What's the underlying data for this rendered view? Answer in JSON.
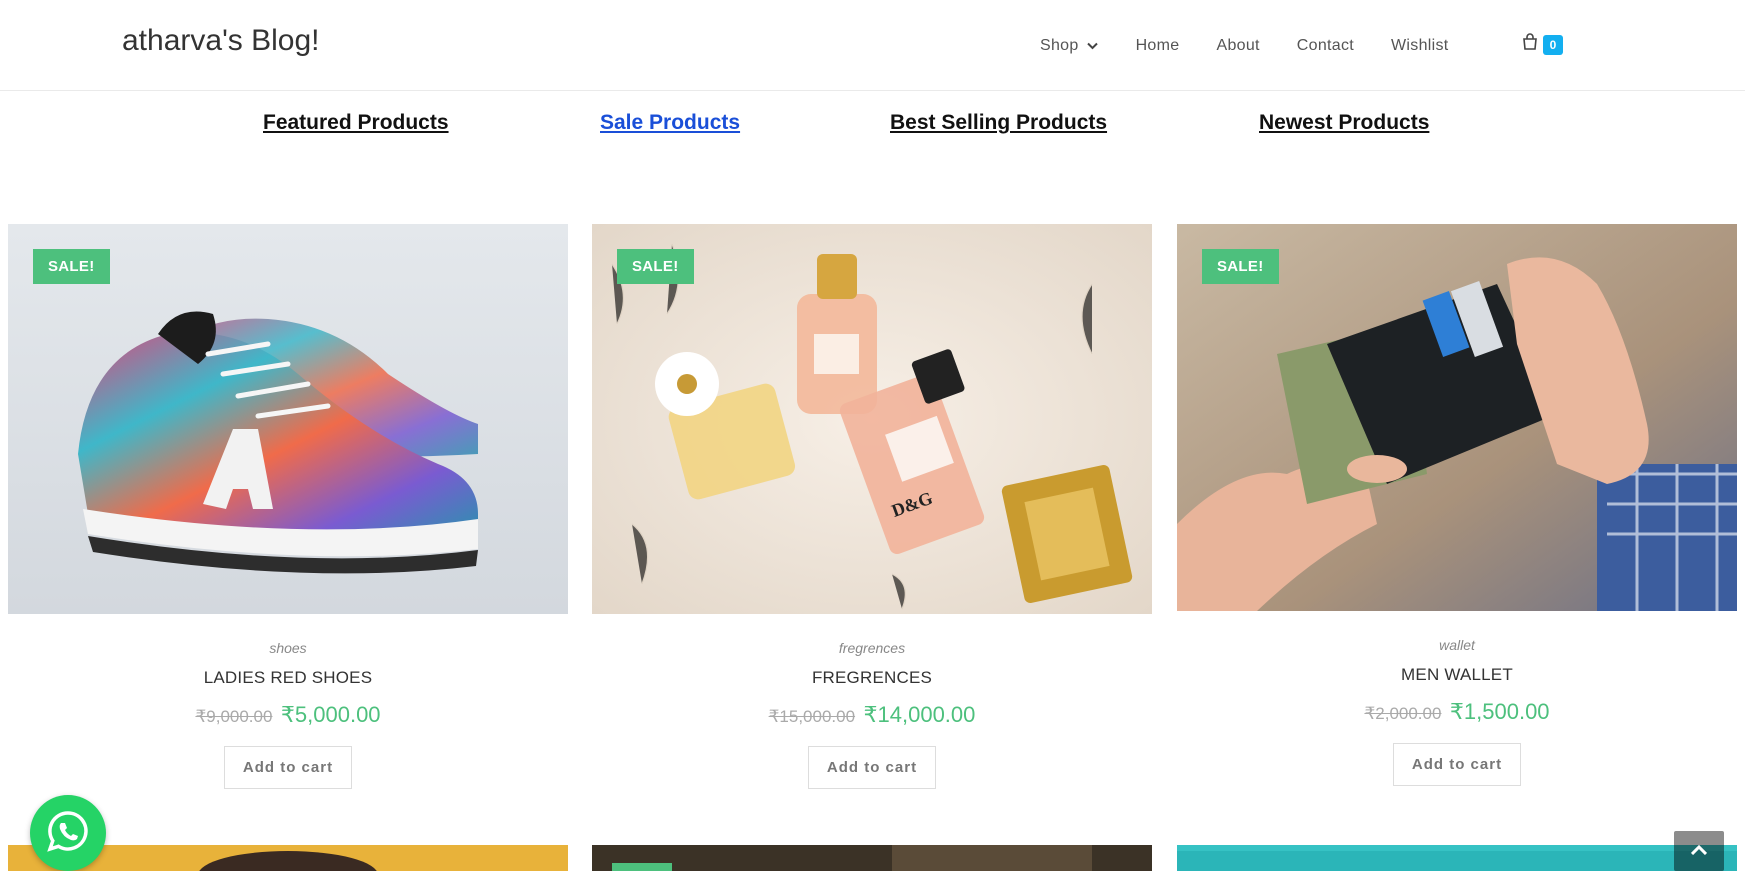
{
  "brand": {
    "title": "atharva's Blog!"
  },
  "nav": {
    "items": [
      {
        "label": "Shop"
      },
      {
        "label": "Home"
      },
      {
        "label": "About"
      },
      {
        "label": "Contact"
      },
      {
        "label": "Wishlist"
      }
    ],
    "cart_count": "0"
  },
  "tabs": [
    {
      "label": "Featured Products"
    },
    {
      "label": "Sale Products"
    },
    {
      "label": "Best Selling Products"
    },
    {
      "label": "Newest Products"
    }
  ],
  "products": [
    {
      "sale_badge": "SALE!",
      "category": "shoes",
      "title": "LADIES RED SHOES",
      "old_price": "₹9,000.00",
      "new_price": "₹5,000.00",
      "button": "Add to cart"
    },
    {
      "sale_badge": "SALE!",
      "category": "fregrences",
      "title": "FREGRENCES",
      "old_price": "₹15,000.00",
      "new_price": "₹14,000.00",
      "button": "Add to cart"
    },
    {
      "sale_badge": "SALE!",
      "category": "wallet",
      "title": "MEN WALLET",
      "old_price": "₹2,000.00",
      "new_price": "₹1,500.00",
      "button": "Add to cart"
    }
  ],
  "colors": {
    "accent": "#13aff0",
    "sale": "#4dc07d",
    "active_tab": "#1a4fd8"
  }
}
